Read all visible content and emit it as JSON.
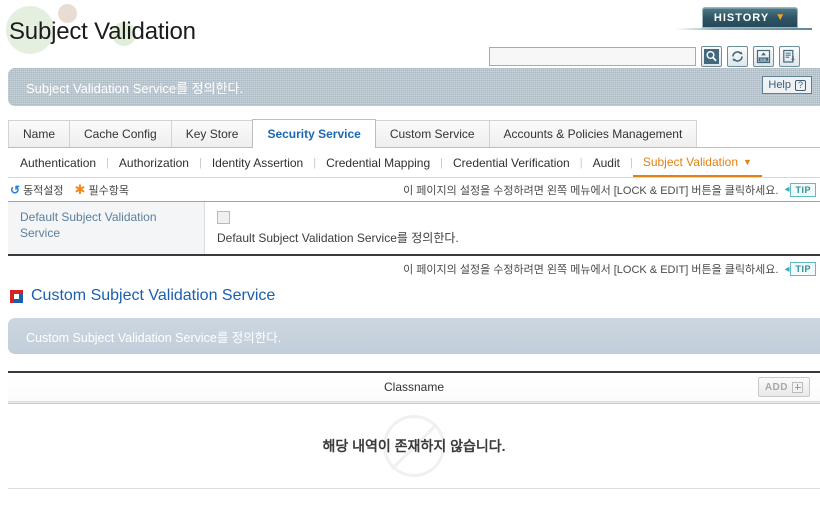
{
  "header": {
    "title": "Subject Validation",
    "history_label": "HISTORY",
    "history_caret": "chevron-down-icon",
    "search_value": "",
    "search_placeholder": "",
    "tool_icons": [
      "search-icon",
      "refresh-icon",
      "xml-export-icon",
      "report-export-icon"
    ],
    "description": "Subject Validation Service를 정의한다.",
    "help_label": "Help",
    "help_icon": "question-mark-icon"
  },
  "tabs": [
    {
      "label": "Name",
      "active": false
    },
    {
      "label": "Cache Config",
      "active": false
    },
    {
      "label": "Key Store",
      "active": false
    },
    {
      "label": "Security Service",
      "active": true
    },
    {
      "label": "Custom Service",
      "active": false
    },
    {
      "label": "Accounts & Policies Management",
      "active": false
    }
  ],
  "subtabs": [
    {
      "label": "Authentication",
      "active": false
    },
    {
      "label": "Authorization",
      "active": false
    },
    {
      "label": "Identity Assertion",
      "active": false
    },
    {
      "label": "Credential Mapping",
      "active": false
    },
    {
      "label": "Credential Verification",
      "active": false
    },
    {
      "label": "Audit",
      "active": false
    },
    {
      "label": "Subject Validation",
      "active": true
    }
  ],
  "legend": {
    "dynamic_label": "동적설정",
    "dynamic_icon": "dynamic-refresh-icon",
    "required_label": "필수항목",
    "required_icon": "asterisk-icon"
  },
  "tip": {
    "text": "이 페이지의 설정을 수정하려면 왼쪽 메뉴에서 [LOCK & EDIT] 버튼을 클릭하세요.",
    "badge": "TIP"
  },
  "property": {
    "label": "Default Subject Validation Service",
    "checkbox_checked": false,
    "description": "Default Subject Validation Service를 정의한다."
  },
  "section": {
    "icon": "square-bullet-icon",
    "title": "Custom Subject Validation Service",
    "description": "Custom Subject Validation Service를 정의한다."
  },
  "classname_table": {
    "header": "Classname",
    "add_label": "ADD",
    "add_icon": "plus-icon",
    "empty_message": "해당 내역이 존재하지 않습니다.",
    "rows": []
  },
  "colors": {
    "accent_blue": "#1b5fae",
    "active_tab_blue": "#1b67b3",
    "active_subtab_orange": "#e08214",
    "tip_teal": "#2f8f96",
    "banner_gray": "#aab9c4",
    "banner_blue": "#c2cedb",
    "history_teal": "#2e5462"
  }
}
